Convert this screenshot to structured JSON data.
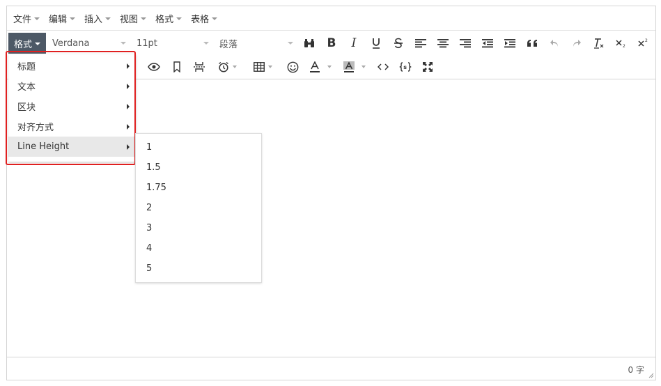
{
  "menubar": {
    "items": [
      "文件",
      "编辑",
      "插入",
      "视图",
      "格式",
      "表格"
    ]
  },
  "toolbar": {
    "format_label": "格式",
    "font_family": "Verdana",
    "font_size": "11pt",
    "block_format": "段落"
  },
  "format_menu": {
    "items": [
      "标题",
      "文本",
      "区块",
      "对齐方式",
      "Line Height"
    ],
    "active_index": 4
  },
  "line_height_menu": {
    "items": [
      "1",
      "1.5",
      "1.75",
      "2",
      "3",
      "4",
      "5"
    ]
  },
  "statusbar": {
    "word_count": "0 字"
  },
  "colors": {
    "format_button_bg": "#4d5966",
    "highlight_border": "#e02020",
    "active_item_bg": "#e8e8e8"
  }
}
